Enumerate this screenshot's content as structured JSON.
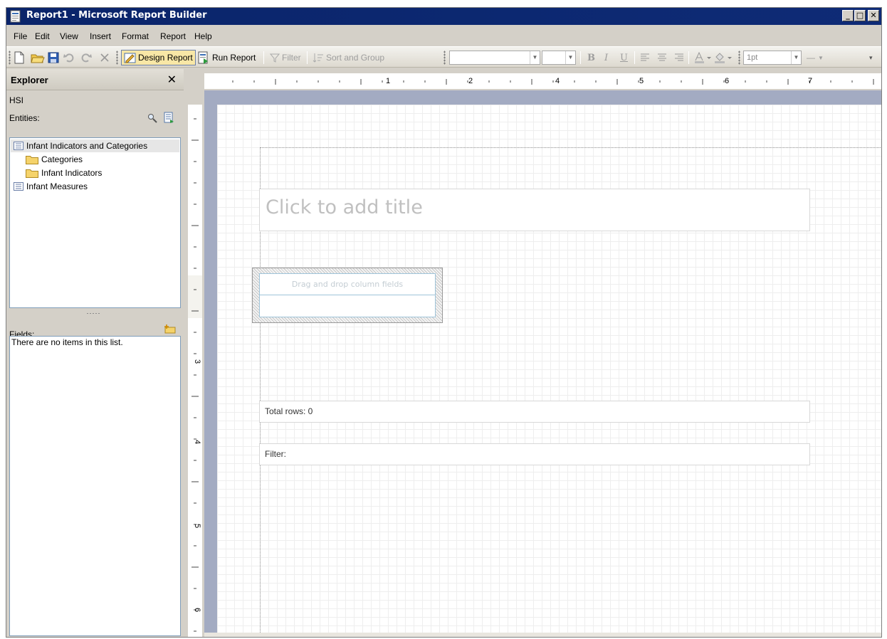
{
  "window": {
    "title": "Report1 - Microsoft Report Builder",
    "controls": {
      "minimize": "_",
      "maximize": "□",
      "close": "✕"
    }
  },
  "menu": [
    "File",
    "Edit",
    "View",
    "Insert",
    "Format",
    "Report",
    "Help"
  ],
  "toolbar": {
    "design_report": "Design Report",
    "run_report": "Run Report",
    "filter": "Filter",
    "sort_and_group": "Sort and Group",
    "bold": "B",
    "italic": "I",
    "underline": "U",
    "line_width": "1pt",
    "line_style": "—"
  },
  "explorer": {
    "title": "Explorer",
    "close": "✕",
    "model": "HSI",
    "entities_label": "Entities:",
    "entities": [
      {
        "label": "Infant Indicators and Categories",
        "type": "entity",
        "selected": true
      },
      {
        "label": "Categories",
        "type": "folder"
      },
      {
        "label": "Infant Indicators",
        "type": "folder"
      },
      {
        "label": "Infant Measures",
        "type": "entity"
      }
    ],
    "fields_label": "Fields:",
    "fields_empty": "There are no items in this list."
  },
  "ruler": {
    "horizontal": [
      "1",
      "2",
      "4",
      "5",
      "6",
      "7"
    ],
    "vertical": [
      "3",
      "4",
      "5",
      "6"
    ]
  },
  "report": {
    "title_placeholder": "Click to add title",
    "table_placeholder": "Drag and drop column fields",
    "total_rows": "Total rows: 0",
    "filter": "Filter:"
  },
  "colors": {
    "titlebar": "#0a246a",
    "surface_background": "#a3abc2",
    "placeholder_text": "#c0c0c0"
  },
  "icons": [
    "report-builder-app-icon",
    "new-icon",
    "open-icon",
    "save-icon",
    "undo-icon",
    "redo-icon",
    "delete-icon",
    "design-report-icon",
    "run-report-icon",
    "filter-icon",
    "sort-group-icon",
    "align-left-icon",
    "align-center-icon",
    "align-right-icon",
    "font-color-icon",
    "fill-color-icon",
    "find-icon",
    "entity-list-icon",
    "folder-icon",
    "add-field-icon"
  ]
}
